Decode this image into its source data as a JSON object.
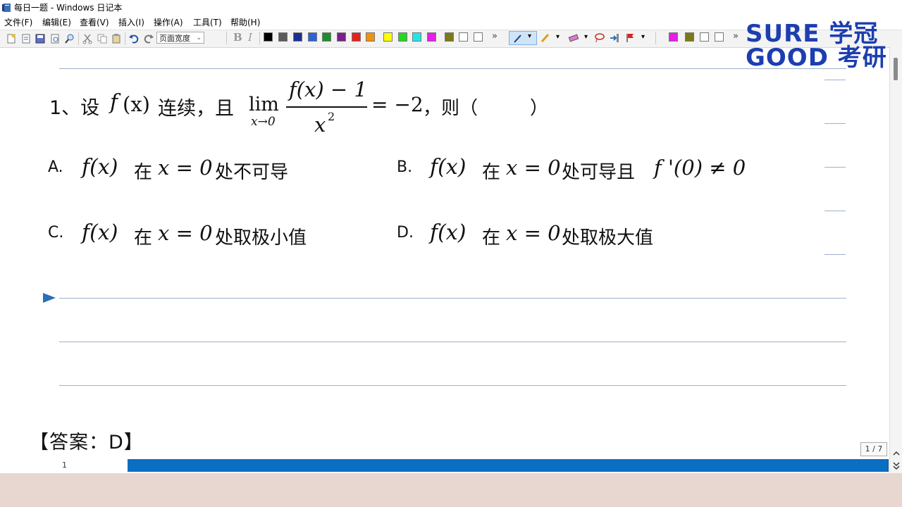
{
  "window": {
    "title": "每日一题 - Windows 日记本"
  },
  "menu": [
    "文件(F)",
    "编辑(E)",
    "查看(V)",
    "插入(I)",
    "操作(A)",
    "工具(T)",
    "帮助(H)"
  ],
  "toolbar": {
    "zoom": "页面宽度",
    "bold": "B",
    "italic": "I",
    "colors": [
      "#000000",
      "#5a5a5a",
      "#1c2f8f",
      "#2c63d8",
      "#1a8f2c",
      "#7a1f8a",
      "#e81f1f",
      "#f0920e",
      "#ffff00",
      "#22d822",
      "#22e6e6",
      "#e61ee6",
      "#7a7a1a",
      "#ffffff",
      "#ffffff"
    ],
    "highlight_colors": [
      "#e61ee6",
      "#7a7a1a",
      "#ffffff",
      "#ffffff"
    ]
  },
  "logo": {
    "line1": "SURE 学冠",
    "line2": "GOOD 考研"
  },
  "question": {
    "number": "1、设",
    "f": "f",
    "x": "(x)",
    "cont": "连续，且",
    "lim": "lim",
    "lim_sub": "x→0",
    "numer": "f(x) − 1",
    "denom_x": "x",
    "denom_exp": "2",
    "rhs": "= −2",
    "then": "，则（",
    "close": "）"
  },
  "options": [
    {
      "letter": "A.",
      "fx": "f(x)",
      "in": "在",
      "xv": "x = 0",
      "text": "处不可导"
    },
    {
      "letter": "B.",
      "fx": "f(x)",
      "in": "在",
      "xv": "x = 0",
      "text": "处可导且",
      "extra": "f '(0) ≠ 0"
    },
    {
      "letter": "C.",
      "fx": "f(x)",
      "in": "在",
      "xv": "x = 0",
      "text": "处取极小值"
    },
    {
      "letter": "D.",
      "fx": "f(x)",
      "in": "在",
      "xv": "x = 0",
      "text": "处取极大值"
    }
  ],
  "answer": "【答案：D】",
  "status": {
    "page_indicator": "1 / 7",
    "page_number": "1"
  }
}
